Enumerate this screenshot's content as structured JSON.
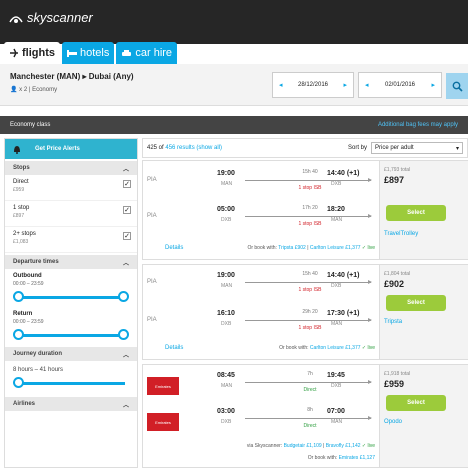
{
  "app": {
    "logo": "skyscanner"
  },
  "tabs": [
    {
      "label": "flights",
      "active": true
    },
    {
      "label": "hotels",
      "active": false
    },
    {
      "label": "car hire",
      "active": false
    }
  ],
  "search": {
    "route": "Manchester (MAN) ▸ Dubai (Any)",
    "passengers": "x 2",
    "cabin": "Economy",
    "depart_date": "28/12/2016",
    "return_date": "02/01/2016"
  },
  "econbar": {
    "cabin": "Economy class",
    "bag_fees": "Additional bag fees may apply"
  },
  "sidebar": {
    "alerts": "Get Price Alerts",
    "stops_title": "Stops",
    "stops": [
      {
        "label": "Direct",
        "price": "£959",
        "checked": true
      },
      {
        "label": "1 stop",
        "price": "£897",
        "checked": true
      },
      {
        "label": "2+ stops",
        "price": "£1,083",
        "checked": true
      }
    ],
    "dep_title": "Departure times",
    "outbound_label": "Outbound",
    "outbound_range": "00:00 – 23:59",
    "return_label": "Return",
    "return_range": "00:00 – 23:59",
    "dur_title": "Journey duration",
    "dur_range": "8 hours – 41 hours",
    "airlines_title": "Airlines"
  },
  "results": {
    "count": "425 of",
    "total_link": "456 results (show all)",
    "sort_label": "Sort by",
    "sort_value": "Price per adult"
  },
  "cards": [
    {
      "legs": [
        {
          "airline": "PIA",
          "dep": "19:00",
          "dep_ap": "MAN",
          "dur": "15h 40",
          "stops": "1 stop ISB",
          "arr": "14:40 (+1)",
          "arr_ap": "DXB"
        },
        {
          "airline": "PIA",
          "dep": "05:00",
          "dep_ap": "DXB",
          "dur": "17h 20",
          "stops": "1 stop ISB",
          "arr": "18:20",
          "arr_ap": "MAN"
        }
      ],
      "total": "£1,793 total",
      "price": "£897",
      "select": "Select",
      "provider": "TravelTrolley",
      "details": "Details",
      "or_book": "Or book with:",
      "alt1": "Tripsta £902",
      "alt2": "Carlton Leisure £1,377",
      "live": "✓ live"
    },
    {
      "legs": [
        {
          "airline": "PIA",
          "dep": "19:00",
          "dep_ap": "MAN",
          "dur": "15h 40",
          "stops": "1 stop ISB",
          "arr": "14:40 (+1)",
          "arr_ap": "DXB"
        },
        {
          "airline": "PIA",
          "dep": "16:10",
          "dep_ap": "DXB",
          "dur": "29h 20",
          "stops": "1 stop ISB",
          "arr": "17:30 (+1)",
          "arr_ap": "MAN"
        }
      ],
      "total": "£1,804 total",
      "price": "£902",
      "select": "Select",
      "provider": "Tripsta",
      "details": "Details",
      "or_book": "Or book with:",
      "alt1": "Carlton Leisure £1,377",
      "live": "✓ live"
    },
    {
      "legs": [
        {
          "airline": "Emirates",
          "dep": "08:45",
          "dep_ap": "MAN",
          "dur": "7h",
          "stops": "Direct",
          "arr": "19:45",
          "arr_ap": "DXB"
        },
        {
          "airline": "Emirates",
          "dep": "03:00",
          "dep_ap": "DXB",
          "dur": "8h",
          "stops": "Direct",
          "arr": "07:00",
          "arr_ap": "MAN"
        }
      ],
      "total": "£1,918 total",
      "price": "£959",
      "select": "Select",
      "provider": "Opodo",
      "via": "via Skyscanner:",
      "via1": "Budgetair £1,109",
      "via2": "Bravofly £1,142",
      "or_book": "Or book with:",
      "alt1": "Emirates £1,127",
      "live": "✓ live"
    }
  ],
  "colors": {
    "brand": "#0aa7e4",
    "select": "#9ccb3b",
    "stop": "#d11f26",
    "direct": "#2e9e3f"
  }
}
